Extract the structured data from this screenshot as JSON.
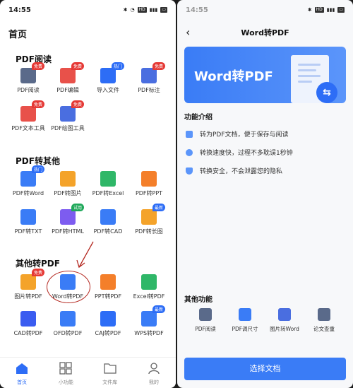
{
  "left": {
    "status_time": "14:55",
    "page_title": "首页",
    "sections": [
      {
        "title": "PDF阅读",
        "items": [
          {
            "label": "PDF阅读",
            "icon": "pdf-read-icon",
            "color": "#5a6a8a",
            "badge": "免费"
          },
          {
            "label": "PDF编辑",
            "icon": "pdf-edit-icon",
            "color": "#e8514a",
            "badge": "免费"
          },
          {
            "label": "导入文件",
            "icon": "import-file-icon",
            "color": "#2d6df6",
            "badge": "热门"
          },
          {
            "label": "PDF标注",
            "icon": "pdf-annotate-icon",
            "color": "#4a6ee0",
            "badge": "免费"
          },
          {
            "label": "PDF文本工具",
            "icon": "pdf-text-tool-icon",
            "color": "#e8514a",
            "badge": "免费"
          },
          {
            "label": "PDF绘图工具",
            "icon": "pdf-draw-tool-icon",
            "color": "#4a6ee0",
            "badge": "免费"
          }
        ]
      },
      {
        "title": "PDF转其他",
        "items": [
          {
            "label": "PDF转Word",
            "icon": "pdf-to-word-icon",
            "color": "#3a7cf6",
            "badge": "热门"
          },
          {
            "label": "PDF转图片",
            "icon": "pdf-to-image-icon",
            "color": "#f4a32a",
            "badge": ""
          },
          {
            "label": "PDF转Excel",
            "icon": "pdf-to-excel-icon",
            "color": "#2fb768",
            "badge": ""
          },
          {
            "label": "PDF转PPT",
            "icon": "pdf-to-ppt-icon",
            "color": "#f47f2a",
            "badge": ""
          },
          {
            "label": "PDF转TXT",
            "icon": "pdf-to-txt-icon",
            "color": "#3a7cf6",
            "badge": ""
          },
          {
            "label": "PDF转HTML",
            "icon": "pdf-to-html-icon",
            "color": "#7d5cf0",
            "badge": "试用"
          },
          {
            "label": "PDF转CAD",
            "icon": "pdf-to-cad-icon",
            "color": "#3a7cf6",
            "badge": ""
          },
          {
            "label": "PDF转长图",
            "icon": "pdf-to-long-image-icon",
            "color": "#f4a32a",
            "badge": "最新"
          }
        ]
      },
      {
        "title": "其他转PDF",
        "items": [
          {
            "label": "图片转PDF",
            "icon": "image-to-pdf-icon",
            "color": "#f4a32a",
            "badge": "免费"
          },
          {
            "label": "Word转PDF",
            "icon": "word-to-pdf-icon",
            "color": "#3a7cf6",
            "badge": ""
          },
          {
            "label": "PPT转PDF",
            "icon": "ppt-to-pdf-icon",
            "color": "#f47f2a",
            "badge": ""
          },
          {
            "label": "Excel转PDF",
            "icon": "excel-to-pdf-icon",
            "color": "#2fb768",
            "badge": ""
          },
          {
            "label": "CAD转PDF",
            "icon": "cad-to-pdf-icon",
            "color": "#3a5cf0",
            "badge": ""
          },
          {
            "label": "OFD转PDF",
            "icon": "ofd-to-pdf-icon",
            "color": "#3a7cf6",
            "badge": ""
          },
          {
            "label": "CAJ转PDF",
            "icon": "caj-to-pdf-icon",
            "color": "#2d6df6",
            "badge": ""
          },
          {
            "label": "WPS转PDF",
            "icon": "wps-to-pdf-icon",
            "color": "#3a7cf6",
            "badge": "最新"
          }
        ]
      }
    ],
    "nav": [
      {
        "label": "首页",
        "icon": "home-icon",
        "active": true
      },
      {
        "label": "小功能",
        "icon": "grid-icon",
        "active": false
      },
      {
        "label": "文件库",
        "icon": "folder-icon",
        "active": false
      },
      {
        "label": "我的",
        "icon": "profile-icon",
        "active": false
      }
    ]
  },
  "right": {
    "status_time": "14:55",
    "title": "Word转PDF",
    "banner_text": "Word转PDF",
    "intro_title": "功能介绍",
    "features": [
      "转为PDF文档，便于保存与阅读",
      "转换速度快，过程不多耽误1秒钟",
      "转换安全，不会泄露您的隐私"
    ],
    "other_title": "其他功能",
    "other_items": [
      {
        "label": "PDF阅读",
        "icon": "pdf-read-icon"
      },
      {
        "label": "PDF调尺寸",
        "icon": "pdf-resize-icon"
      },
      {
        "label": "图片转Word",
        "icon": "image-to-word-icon"
      },
      {
        "label": "论文查重",
        "icon": "paper-check-icon"
      }
    ],
    "select_button": "选择文档"
  }
}
